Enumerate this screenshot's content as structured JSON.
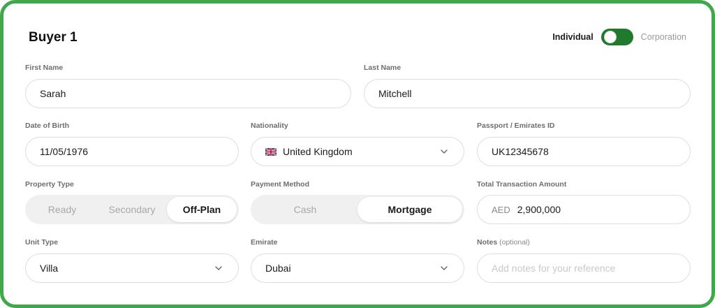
{
  "buyer": {
    "title": "Buyer 1"
  },
  "buyer_type": {
    "left": "Individual",
    "right": "Corporation",
    "selected": "Individual",
    "accent": "#1f7a2e"
  },
  "fields": {
    "first_name": {
      "label": "First Name",
      "value": "Sarah"
    },
    "last_name": {
      "label": "Last Name",
      "value": "Mitchell"
    },
    "dob": {
      "label": "Date of Birth",
      "value": "11/05/1976"
    },
    "nationality": {
      "label": "Nationality",
      "value": "United Kingdom",
      "icon": "uk-flag-icon"
    },
    "passport": {
      "label": "Passport / Emirates ID",
      "value": "UK12345678"
    },
    "property_type": {
      "label": "Property Type",
      "options": [
        "Ready",
        "Secondary",
        "Off-Plan"
      ],
      "selected": "Off-Plan"
    },
    "payment_method": {
      "label": "Payment Method",
      "options": [
        "Cash",
        "Mortgage"
      ],
      "selected": "Mortgage"
    },
    "amount": {
      "label": "Total Transaction Amount",
      "currency": "AED",
      "value": "2,900,000"
    },
    "unit_type": {
      "label": "Unit Type",
      "value": "Villa"
    },
    "emirate": {
      "label": "Emirate",
      "value": "Dubai"
    },
    "notes": {
      "label": "Notes",
      "label_suffix": "(optional)",
      "placeholder": "Add notes for your reference"
    }
  },
  "colors": {
    "frame": "#3fa84a",
    "toggle_on": "#1f7a2e"
  }
}
